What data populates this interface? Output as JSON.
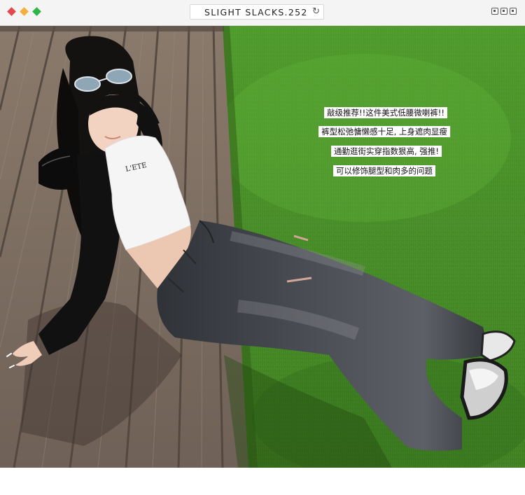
{
  "window": {
    "controls_colors": [
      "#e5484d",
      "#f3b03d",
      "#2fb545"
    ],
    "address": "SLIGHT SLACKS.252",
    "reload_icon": "reload-icon"
  },
  "photo": {
    "overlay_lines": [
      "敲级推荐!!这件美式低腰微喇裤!!",
      "裤型松弛慵懒感十足, 上身遮肉显瘦",
      "通勤逛街实穿指数狠高, 强推!",
      "可以修饰腿型和肉多的问题"
    ],
    "shirt_print": "L'ETE",
    "colors": {
      "grass": "#4e8f2c",
      "deck": "#7e6e62",
      "denim": "#3d4046"
    }
  }
}
